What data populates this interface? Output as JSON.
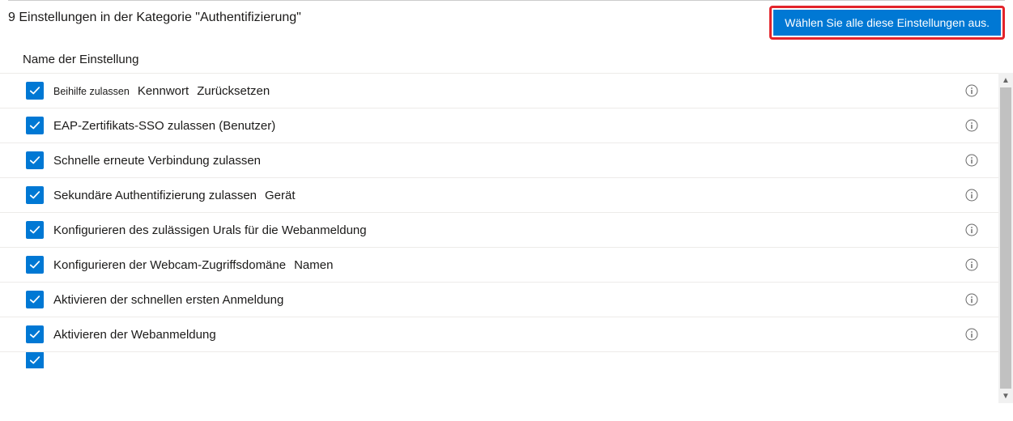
{
  "header": {
    "count": "9",
    "title_text": "Einstellungen in der Kategorie \"Authentifizierung\"",
    "select_all_label": "Wählen Sie alle diese Einstellungen aus."
  },
  "table": {
    "column_header": "Name der Einstellung"
  },
  "rows": [
    {
      "checked": true,
      "small": "Beihilfe zulassen",
      "main": "Kennwort",
      "extra": "Zurücksetzen"
    },
    {
      "checked": true,
      "main": "EAP-Zertifikats-SSO zulassen (Benutzer)"
    },
    {
      "checked": true,
      "main": "Schnelle erneute Verbindung zulassen"
    },
    {
      "checked": true,
      "main": "Sekundäre Authentifizierung zulassen",
      "extra": "Gerät"
    },
    {
      "checked": true,
      "main": "Konfigurieren des zulässigen Urals für die Webanmeldung"
    },
    {
      "checked": true,
      "main": "Konfigurieren der Webcam-Zugriffsdomäne",
      "extra": "Namen"
    },
    {
      "checked": true,
      "main": "Aktivieren der schnellen ersten Anmeldung"
    },
    {
      "checked": true,
      "main": "Aktivieren der Webanmeldung"
    }
  ]
}
